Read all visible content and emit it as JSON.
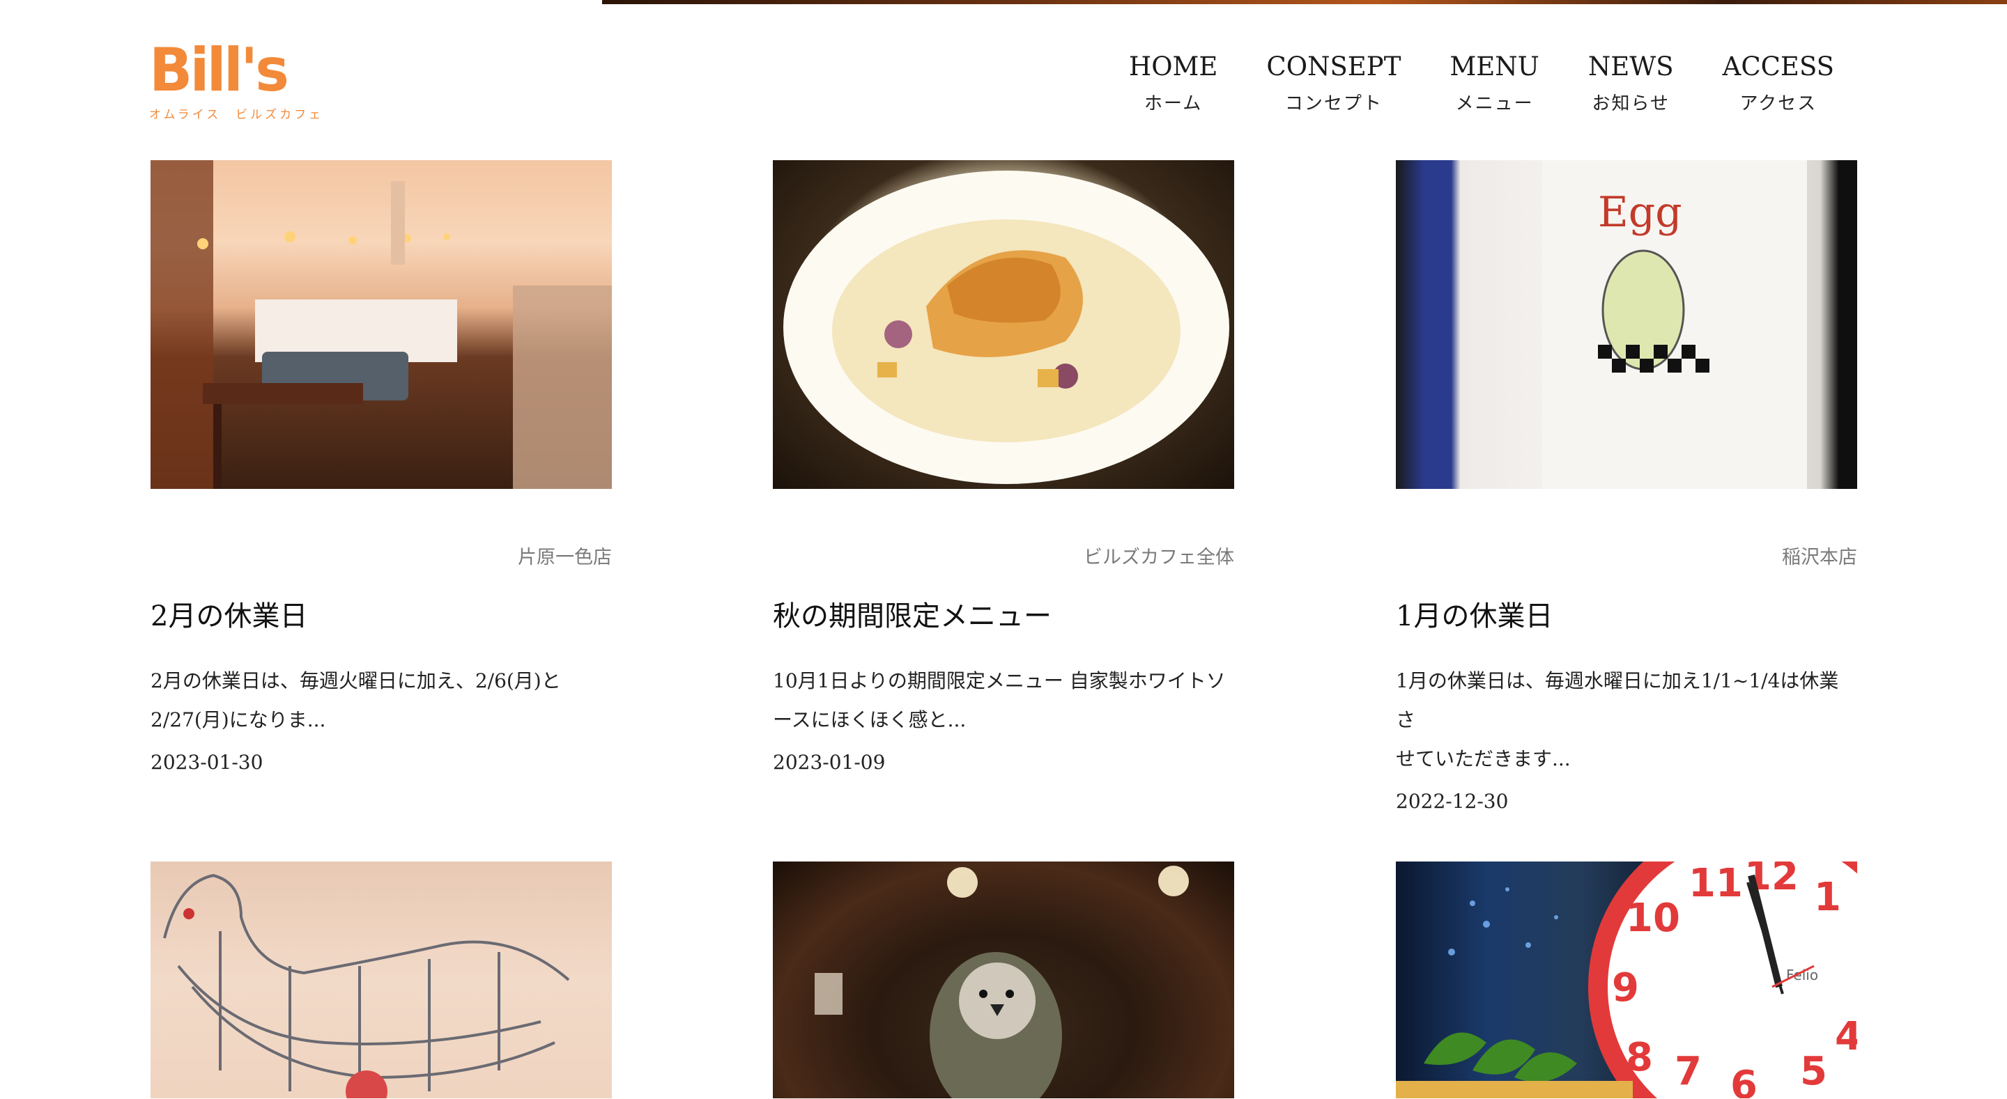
{
  "brand": {
    "logo_text": "Bill's",
    "logo_sub": "オムライス　ビルズカフェ",
    "accent": "#f28a3a"
  },
  "nav": [
    {
      "en": "HOME",
      "ja": "ホーム"
    },
    {
      "en": "CONSEPT",
      "ja": "コンセプト"
    },
    {
      "en": "MENU",
      "ja": "メニュー"
    },
    {
      "en": "NEWS",
      "ja": "お知らせ"
    },
    {
      "en": "ACCESS",
      "ja": "アクセス"
    }
  ],
  "posts": [
    {
      "store": "片原一色店",
      "title": "2月の休業日",
      "excerpt_line1": "2月の休業日は、毎週火曜日に加え、2/6(月)と",
      "excerpt_line2": "2/27(月)になりま...",
      "date": "2023-01-30"
    },
    {
      "store": "ビルズカフェ全体",
      "title": "秋の期間限定メニュー",
      "excerpt_line1": "10月1日よりの期間限定メニュー 自家製ホワイトソ",
      "excerpt_line2": "ースにほくほく感と...",
      "date": "2023-01-09"
    },
    {
      "store": "稲沢本店",
      "title": "1月の休業日",
      "excerpt_line1": "1月の休業日は、毎週水曜日に加え1/1~1/4は休業さ",
      "excerpt_line2": "せていただきます...",
      "date": "2022-12-30"
    }
  ],
  "photo_texts": {
    "egg_print": "Egg",
    "clock_brand": "Felio"
  }
}
